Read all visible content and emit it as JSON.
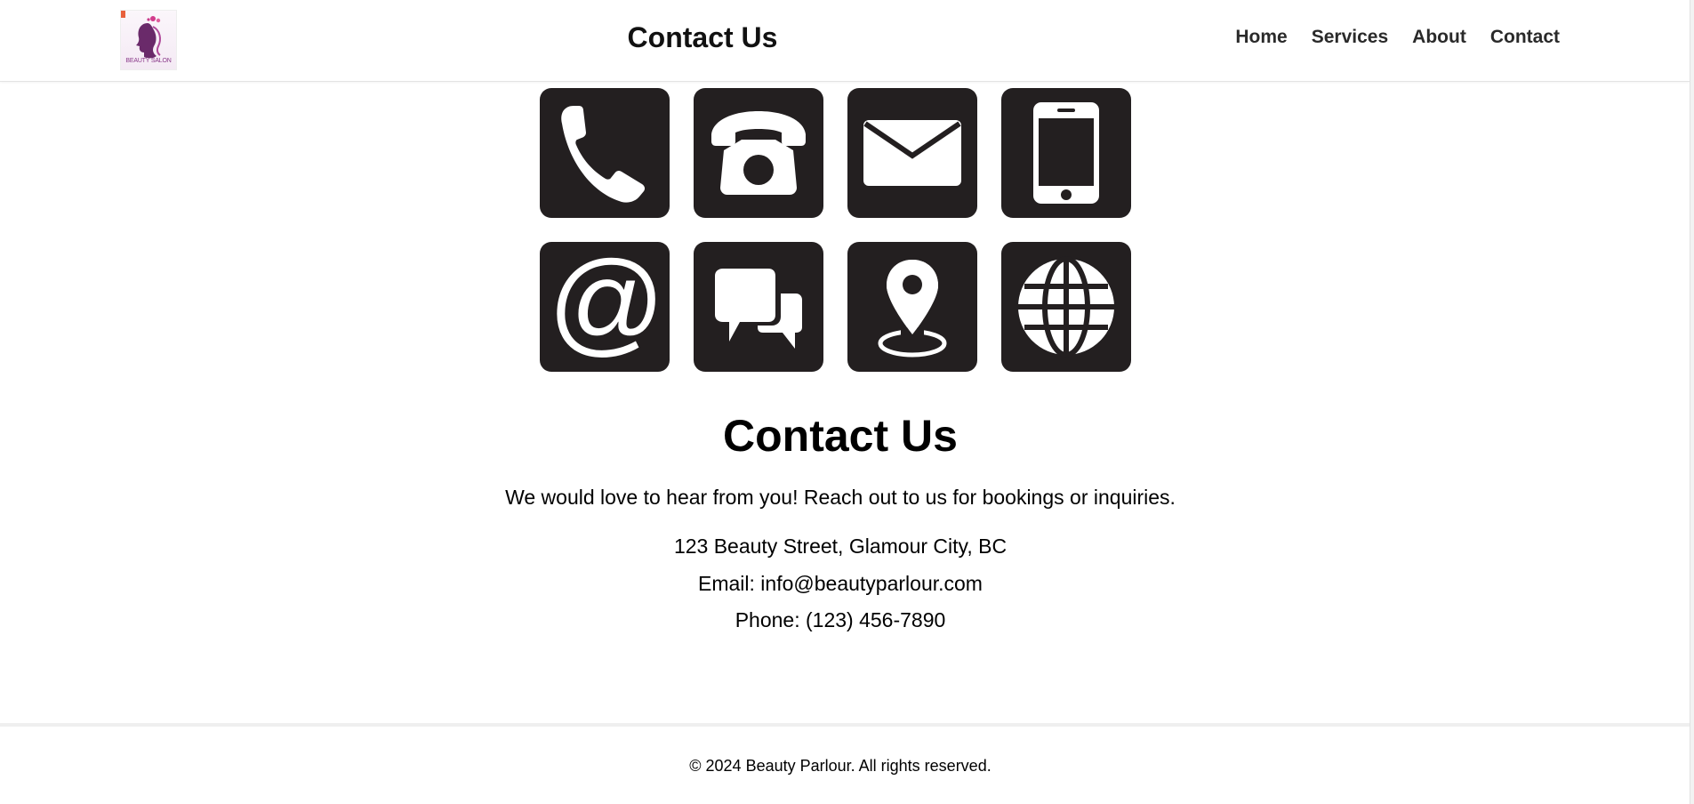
{
  "header": {
    "logo_text": "BEAUTY SALON",
    "title": "Contact Us",
    "nav": [
      {
        "label": "Home"
      },
      {
        "label": "Services"
      },
      {
        "label": "About"
      },
      {
        "label": "Contact"
      }
    ]
  },
  "icons": [
    "phone-handset-icon",
    "telephone-icon",
    "envelope-icon",
    "mobile-phone-icon",
    "at-sign-icon",
    "chat-bubbles-icon",
    "location-pin-icon",
    "globe-icon"
  ],
  "contact": {
    "heading": "Contact Us",
    "intro": "We would love to hear from you! Reach out to us for bookings or inquiries.",
    "address": "123 Beauty Street, Glamour City, BC",
    "email": "Email: info@beautyparlour.com",
    "phone": "Phone: (123) 456-7890"
  },
  "footer": {
    "copyright": "© 2024 Beauty Parlour. All rights reserved."
  },
  "colors": {
    "icon_tile": "#231f20",
    "logo_accent": "#8a3a8a"
  }
}
